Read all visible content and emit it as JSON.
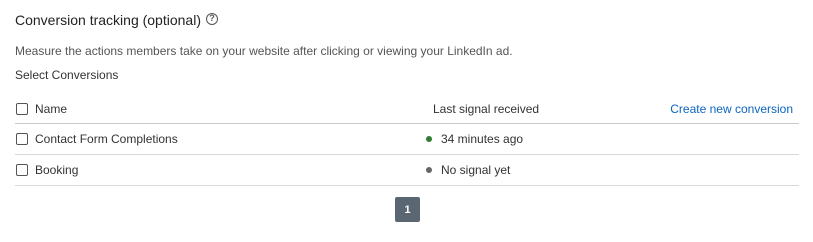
{
  "section": {
    "title": "Conversion tracking (optional)",
    "help_icon": "question-circle-icon",
    "description": "Measure the actions members take on your website after clicking or viewing your LinkedIn ad.",
    "select_label": "Select Conversions"
  },
  "table": {
    "columns": {
      "name": "Name",
      "last_signal": "Last signal received"
    },
    "create_link": "Create new conversion",
    "rows": [
      {
        "name": "Contact Form Completions",
        "signal": "34 minutes ago",
        "status_color": "#2e7d32"
      },
      {
        "name": "Booking",
        "signal": "No signal yet",
        "status_color": "#666666"
      }
    ]
  },
  "pagination": {
    "current_page": "1",
    "button_color": "#5a6773"
  },
  "colors": {
    "link": "#0a66c2",
    "active_dot": "#2e7d32",
    "inactive_dot": "#666666"
  }
}
